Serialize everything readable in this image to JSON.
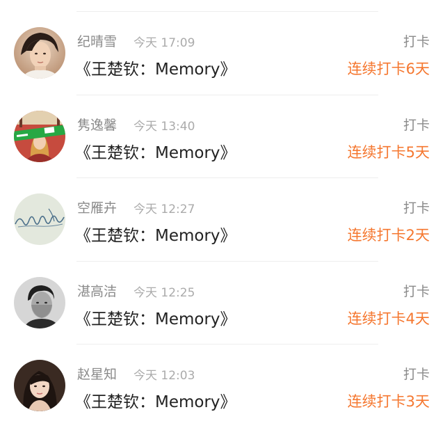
{
  "checkins": [
    {
      "name": "纪晴雪",
      "time": "今天 17:09",
      "action": "打卡",
      "title": "《王楚钦：Memory》",
      "streak": "连续打卡6天",
      "avatar_icon": "portrait-photo"
    },
    {
      "name": "隽逸馨",
      "time": "今天 13:40",
      "action": "打卡",
      "title": "《王楚钦：Memory》",
      "streak": "连续打卡5天",
      "avatar_icon": "banner-portrait-photo"
    },
    {
      "name": "空雁卉",
      "time": "今天 12:27",
      "action": "打卡",
      "title": "《王楚钦：Memory》",
      "streak": "连续打卡2天",
      "avatar_icon": "handwriting-photo"
    },
    {
      "name": "湛高洁",
      "time": "今天 12:25",
      "action": "打卡",
      "title": "《王楚钦：Memory》",
      "streak": "连续打卡4天",
      "avatar_icon": "grayscale-portrait-photo"
    },
    {
      "name": "赵星知",
      "time": "今天 12:03",
      "action": "打卡",
      "title": "《王楚钦：Memory》",
      "streak": "连续打卡3天",
      "avatar_icon": "portrait-photo"
    }
  ],
  "colors": {
    "streak": "#f5772f",
    "name": "#8a8a8a",
    "time": "#ababab",
    "title": "#222222",
    "divider": "#eeeeee"
  }
}
